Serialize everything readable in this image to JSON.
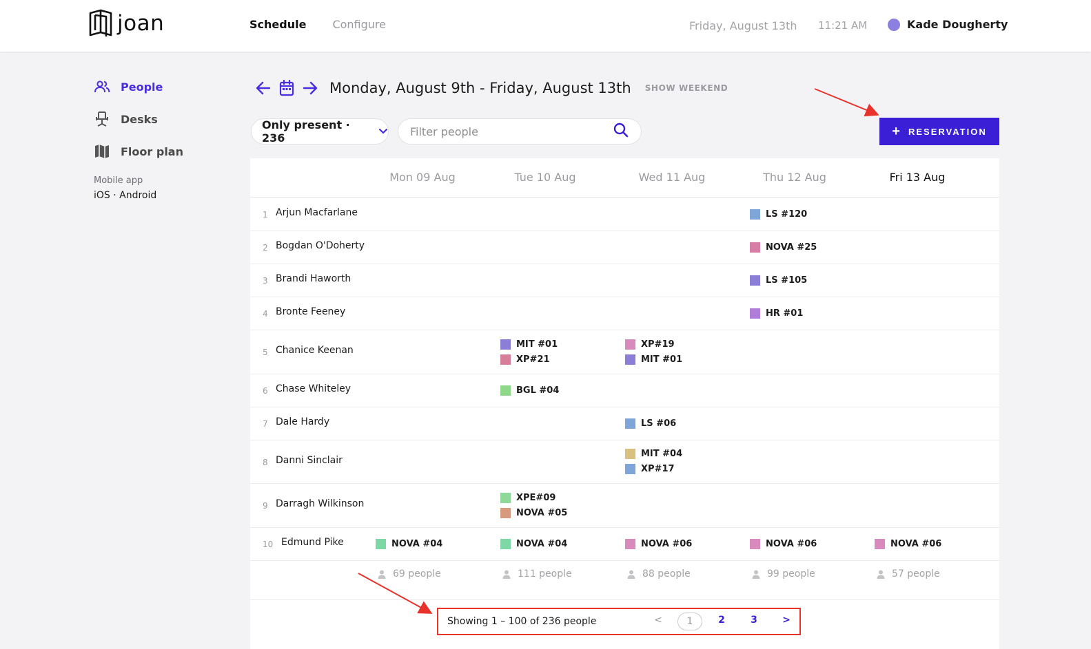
{
  "header": {
    "logo_text": "joan",
    "nav": [
      {
        "label": "Schedule",
        "active": true
      },
      {
        "label": "Configure",
        "active": false
      }
    ],
    "date": "Friday, August 13th",
    "time": "11:21 AM",
    "user": {
      "name": "Kade Dougherty",
      "avatar_color": "#8b7fe0"
    }
  },
  "sidebar": {
    "items": [
      {
        "label": "People",
        "icon": "people-icon",
        "active": true
      },
      {
        "label": "Desks",
        "icon": "desk-chair-icon",
        "active": false
      },
      {
        "label": "Floor plan",
        "icon": "map-icon",
        "active": false
      }
    ],
    "mobile_label": "Mobile app",
    "mobile_links": "iOS · Android"
  },
  "schedule": {
    "range_title": "Monday, August 9th - Friday, August 13th",
    "show_weekend": "SHOW WEEKEND",
    "filter": {
      "label": "Only present · 236"
    },
    "search": {
      "placeholder": "Filter people",
      "value": ""
    },
    "reservation_button": "RESERVATION",
    "days": [
      "Mon 09 Aug",
      "Tue 10 Aug",
      "Wed 11 Aug",
      "Thu 12 Aug",
      "Fri 13 Aug"
    ],
    "today_index": 4,
    "rows": [
      {
        "num": "1",
        "name": "Arjun Macfarlane",
        "cells": [
          [],
          [],
          [],
          [
            {
              "label": "LS #120",
              "color": "#7ea6d8"
            }
          ],
          []
        ]
      },
      {
        "num": "2",
        "name": "Bogdan O'Doherty",
        "cells": [
          [],
          [],
          [],
          [
            {
              "label": "NOVA #25",
              "color": "#d67ea6"
            }
          ],
          []
        ]
      },
      {
        "num": "3",
        "name": "Brandi Haworth",
        "cells": [
          [],
          [],
          [],
          [
            {
              "label": "LS #105",
              "color": "#8a7ed6"
            }
          ],
          []
        ]
      },
      {
        "num": "4",
        "name": "Bronte Feeney",
        "cells": [
          [],
          [],
          [],
          [
            {
              "label": "HR #01",
              "color": "#b07ed8"
            }
          ],
          []
        ]
      },
      {
        "num": "5",
        "name": "Chanice Keenan",
        "cells": [
          [],
          [
            {
              "label": "MIT #01",
              "color": "#8a7ed6"
            },
            {
              "label": "XP#21",
              "color": "#d67e9a"
            }
          ],
          [
            {
              "label": "XP#19",
              "color": "#d88abc"
            },
            {
              "label": "MIT #01",
              "color": "#8a7ed6"
            }
          ],
          [],
          []
        ]
      },
      {
        "num": "6",
        "name": "Chase Whiteley",
        "cells": [
          [],
          [
            {
              "label": "BGL #04",
              "color": "#8ed88a"
            }
          ],
          [],
          [],
          []
        ]
      },
      {
        "num": "7",
        "name": "Dale Hardy",
        "cells": [
          [],
          [],
          [
            {
              "label": "LS #06",
              "color": "#7ea6d8"
            }
          ],
          [],
          []
        ]
      },
      {
        "num": "8",
        "name": "Danni Sinclair",
        "cells": [
          [],
          [],
          [
            {
              "label": "MIT #04",
              "color": "#d8c07e"
            },
            {
              "label": "XP#17",
              "color": "#7ea6d8"
            }
          ],
          [],
          []
        ]
      },
      {
        "num": "9",
        "name": "Darragh Wilkinson",
        "cells": [
          [],
          [
            {
              "label": "XPE#09",
              "color": "#8ed89a"
            },
            {
              "label": "NOVA #05",
              "color": "#d89a7e"
            }
          ],
          [],
          [],
          []
        ]
      },
      {
        "num": "10",
        "name": "Edmund Pike",
        "cells": [
          [
            {
              "label": "NOVA #04",
              "color": "#7ed8a6"
            }
          ],
          [
            {
              "label": "NOVA #04",
              "color": "#7ed8a6"
            }
          ],
          [
            {
              "label": "NOVA #06",
              "color": "#d88abc"
            }
          ],
          [
            {
              "label": "NOVA #06",
              "color": "#d88abc"
            }
          ],
          [
            {
              "label": "NOVA #06",
              "color": "#d88abc"
            }
          ]
        ]
      }
    ],
    "counts": [
      "69 people",
      "111 people",
      "88 people",
      "99 people",
      "57 people"
    ],
    "pagination": {
      "showing": "Showing 1 – 100 of 236 people",
      "prev": "<",
      "pages": [
        "1",
        "2",
        "3"
      ],
      "current": "1",
      "next": ">"
    }
  },
  "colors": {
    "accent": "#3a1fd6",
    "annotation": "#e8322b"
  }
}
